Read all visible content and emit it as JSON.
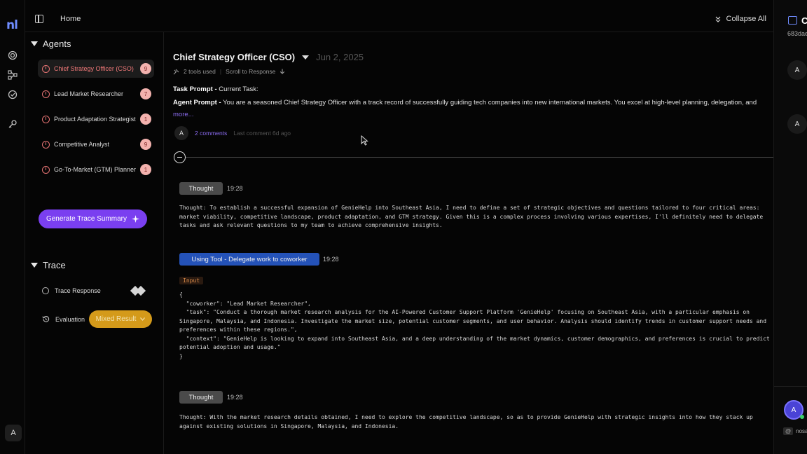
{
  "app": {
    "logo": "nl",
    "rail_avatar": "A"
  },
  "topbar": {
    "home": "Home",
    "collapse_all": "Collapse All"
  },
  "agents_section": {
    "title": "Agents",
    "items": [
      {
        "label": "Chief Strategy Officer (CSO)",
        "count": "9",
        "active": true
      },
      {
        "label": "Lead Market Researcher",
        "count": "7"
      },
      {
        "label": "Product Adaptation Strategist",
        "count": "1"
      },
      {
        "label": "Competitive Analyst",
        "count": "9"
      },
      {
        "label": "Go-To-Market (GTM) Planner",
        "count": "1"
      }
    ],
    "generate_button": "Generate Trace Summary"
  },
  "trace_section": {
    "title": "Trace",
    "trace_response": "Trace Response",
    "evaluation": "Evaluation",
    "evaluation_value": "Mixed Result"
  },
  "main": {
    "title": "Chief Strategy Officer (CSO)",
    "date": "Jun 2, 2025",
    "tools_used": "2 tools used",
    "scroll_link": "Scroll to Response",
    "task_prompt_label": "Task Prompt -",
    "task_prompt_value": "Current Task:",
    "agent_prompt_label": "Agent Prompt -",
    "agent_prompt_value": "You are a seasoned Chief Strategy Officer with a track record of successfully guiding tech companies into new international markets. You excel at high-level planning, delegation, and",
    "more": "more...",
    "comment_avatar": "A",
    "comments": "2 comments",
    "last_comment": "Last comment 6d ago",
    "events": [
      {
        "type": "thought",
        "label": "Thought",
        "time": "19:28",
        "text": "Thought: To establish a successful expansion of GenieHelp into Southeast Asia, I need to define a set of strategic objectives and questions tailored to four critical areas:\nmarket viability, competitive landscape, product adaptation, and GTM strategy. Given this is a complex process involving various expertises, I'll definitely need to delegate\ntasks and ask relevant questions to my team to achieve comprehensive insights."
      },
      {
        "type": "tool",
        "label": "Using Tool - Delegate work to coworker",
        "time": "19:28",
        "input_label": "Input",
        "text": "{\n  \"coworker\": \"Lead Market Researcher\",\n  \"task\": \"Conduct a thorough market research analysis for the AI-Powered Customer Support Platform 'GenieHelp' focusing on Southeast Asia, with a particular emphasis on\nSingapore, Malaysia, and Indonesia. Investigate the market size, potential customer segments, and user behavior. Analysis should identify trends in customer support needs and\npreferences within these regions.\",\n  \"context\": \"GenieHelp is looking to expand into Southeast Asia, and a deep understanding of the market dynamics, customer demographics, and preferences is crucial to predict\npotential adoption and usage.\"\n}"
      },
      {
        "type": "thought",
        "label": "Thought",
        "time": "19:28",
        "text": "Thought: With the market research details obtained, I need to explore the competitive landscape, so as to provide GenieHelp with strategic insights into how they stack up\nagainst existing solutions in Singapore, Malaysia, and Indonesia."
      }
    ]
  },
  "right_panel": {
    "title": "C",
    "id": "683dae",
    "avatar_1": "A",
    "avatar_2": "A",
    "user_avatar": "A",
    "mention_at": "@",
    "mention_text": "nosai"
  },
  "colors": {
    "accent_purple": "#7a3ff0",
    "tool_blue": "#2452b8",
    "mixed_result": "#d49a1a",
    "alert_red": "#e57373"
  }
}
